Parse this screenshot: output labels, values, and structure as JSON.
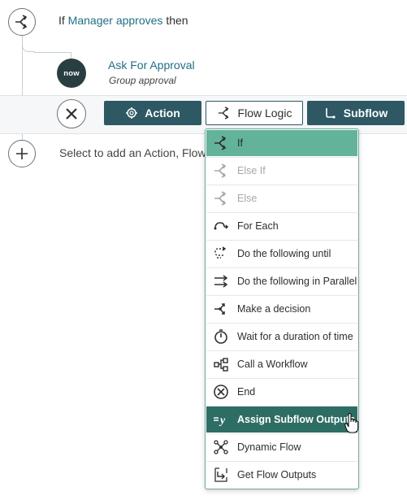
{
  "flow": {
    "if_keyword": "If",
    "if_link": "Manager approves",
    "if_then": "then",
    "step_logo": "now",
    "step_title": "Ask For Approval",
    "step_subtitle": "Group approval",
    "add_text": "Select to add an Action, Flow"
  },
  "toolbar": {
    "action_label": "Action",
    "flow_logic_label": "Flow Logic",
    "subflow_label": "Subflow"
  },
  "menu": {
    "items": [
      {
        "label": "If",
        "icon": "branch-icon",
        "state": "selected"
      },
      {
        "label": "Else If",
        "icon": "branch-icon",
        "state": "disabled"
      },
      {
        "label": "Else",
        "icon": "branch-icon",
        "state": "disabled"
      },
      {
        "label": "For Each",
        "icon": "loop-icon",
        "state": "normal"
      },
      {
        "label": "Do the following until",
        "icon": "dotted-loop-icon",
        "state": "normal"
      },
      {
        "label": "Do the following in Parallel",
        "icon": "parallel-arrows-icon",
        "state": "normal"
      },
      {
        "label": "Make a decision",
        "icon": "decision-icon",
        "state": "normal"
      },
      {
        "label": "Wait for a duration of time",
        "icon": "timer-icon",
        "state": "normal"
      },
      {
        "label": "Call a Workflow",
        "icon": "workflow-icon",
        "state": "normal"
      },
      {
        "label": "End",
        "icon": "end-icon",
        "state": "normal"
      },
      {
        "label": "Assign Subflow Outputs",
        "icon": "assign-y-icon",
        "state": "hovered"
      },
      {
        "label": "Dynamic Flow",
        "icon": "dynamic-flow-icon",
        "state": "normal"
      },
      {
        "label": "Get Flow Outputs",
        "icon": "get-outputs-icon",
        "state": "normal"
      }
    ]
  },
  "colors": {
    "toolbar_dark": "#2e5863",
    "menu_selected": "#62b39a",
    "menu_hover": "#2e6d63",
    "link": "#1f6f84"
  }
}
